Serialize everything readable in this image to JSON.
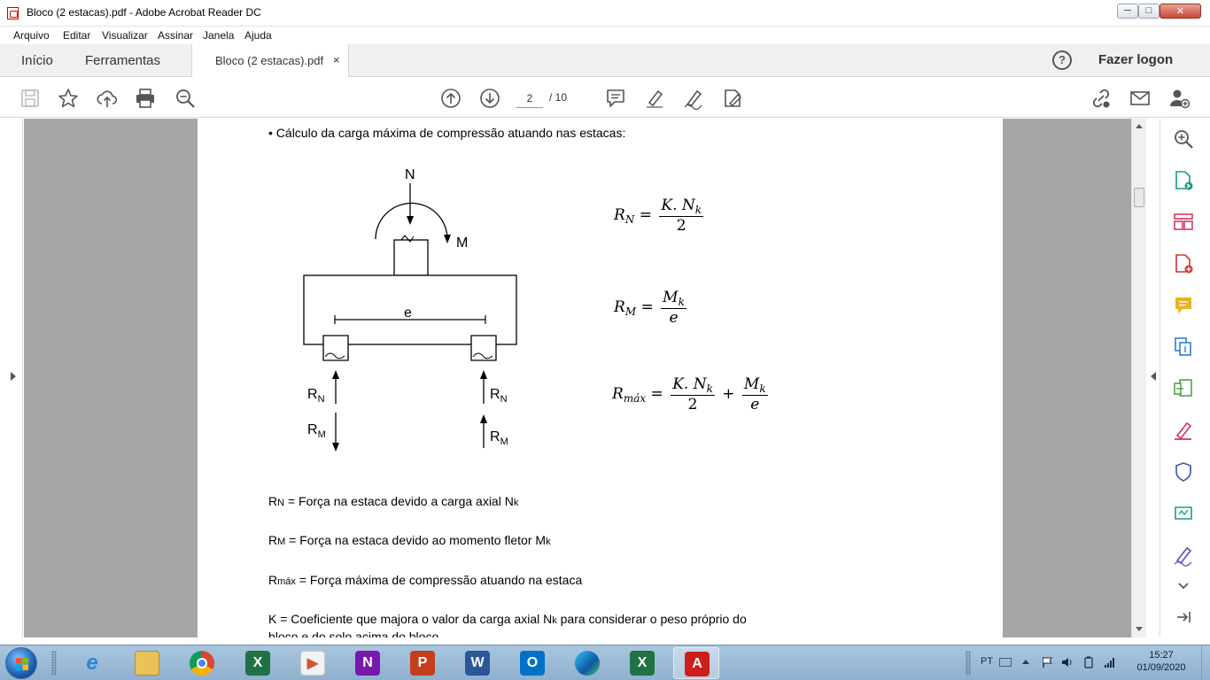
{
  "window": {
    "title": "Bloco (2 estacas).pdf - Adobe Acrobat Reader DC",
    "minimize": "─",
    "maximize": "□",
    "close": "✕"
  },
  "menu": [
    "Arquivo",
    "Editar",
    "Visualizar",
    "Assinar",
    "Janela",
    "Ajuda"
  ],
  "tabs": {
    "home": "Início",
    "tools": "Ferramentas",
    "document": "Bloco (2 estacas).pdf",
    "close": "×",
    "help": "?",
    "login": "Fazer logon"
  },
  "toolbar": {
    "page_current": "2",
    "page_total": "/ 10",
    "icons": [
      "save-icon",
      "bookmark-star-icon",
      "upload-cloud-icon",
      "print-icon",
      "zoom-search-icon",
      "page-up-icon",
      "page-down-icon",
      "comment-icon",
      "highlight-pen-icon",
      "sign-pen-icon",
      "fill-sign-icon",
      "share-link-icon",
      "mail-icon",
      "add-user-icon"
    ]
  },
  "right_panel_icons": [
    "zoom-tool-icon",
    "export-pdf-icon",
    "organize-pages-icon",
    "create-pdf-icon",
    "comment-tool-icon",
    "combine-files-icon",
    "compress-pdf-icon",
    "fill-sign-tool-icon",
    "protect-shield-icon",
    "send-review-icon",
    "certificate-sign-icon",
    "more-tools-chevron-icon",
    "collapse-panel-icon"
  ],
  "document": {
    "heading": "Cálculo da carga máxima de compressão atuando nas estacas:",
    "diagram": {
      "n": "N",
      "m": "M",
      "e": "e",
      "rn": "R",
      "rn_sub": "N",
      "rm": "R",
      "rm_sub": "M"
    },
    "formulas": {
      "rn_lhs": "R",
      "rn_lhs_sub": "N",
      "rn_num": "K. N",
      "rn_num_sub": "k",
      "rn_den": "2",
      "rm_lhs": "R",
      "rm_lhs_sub": "M",
      "rm_num": "M",
      "rm_num_sub": "k",
      "rm_den": "e",
      "rmax_lhs": "R",
      "rmax_lhs_sub": "máx",
      "rmax_num1": "K. N",
      "rmax_num1_sub": "k",
      "rmax_den1": "2",
      "rmax_num2": "M",
      "rmax_num2_sub": "k",
      "rmax_den2": "e",
      "eq": "=",
      "plus": "+"
    },
    "definitions": {
      "rn_prefix": "R",
      "rn_prefix_sub": "N",
      "rn_text": " = Força na estaca devido a carga axial N",
      "rn_text_sub": "k",
      "rm_prefix": "R",
      "rm_prefix_sub": "M",
      "rm_text": " = Força na estaca devido ao momento fletor M",
      "rm_text_sub": "k",
      "rmax_prefix": "R",
      "rmax_prefix_sub": "máx",
      "rmax_text": " = Força máxima de compressão atuando na estaca",
      "k_text": "K = Coeficiente que majora o valor da carga axial N",
      "k_text_sub": "k",
      "k_text_end": " para considerar o peso próprio do",
      "k_text_line2": "bloco e do solo acima do bloco"
    }
  },
  "taskbar": {
    "apps": [
      "internet-explorer",
      "file-explorer",
      "chrome",
      "excel",
      "powerpoint-viewer",
      "onenote",
      "powerpoint",
      "word",
      "outlook",
      "edge",
      "excel",
      "acrobat"
    ],
    "lang": "PT",
    "time": "15:27",
    "date": "01/09/2020"
  },
  "colors": {
    "acrobat_red": "#cc1f1a",
    "panel_gray": "#a6a6a6",
    "taskbar": "#9fbcd8"
  }
}
